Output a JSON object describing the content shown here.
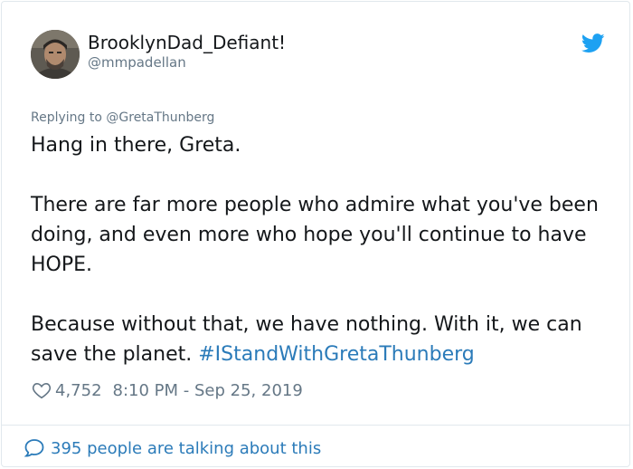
{
  "author": {
    "display_name": "BrooklynDad_Defiant!",
    "handle": "@mmpadellan",
    "avatar": "user-avatar-photo"
  },
  "reply_to": {
    "prefix": "Replying to",
    "mention": "@GretaThunberg"
  },
  "tweet": {
    "paragraphs": [
      "Hang in there, Greta.",
      "There are far more people who admire what you've been doing, and even more who hope you'll continue to have HOPE.",
      "Because without that, we have nothing. With it, we can save the planet."
    ],
    "hashtag": "#IStandWithGretaThunberg"
  },
  "meta": {
    "likes": "4,752",
    "timestamp": "8:10 PM - Sep 25, 2019"
  },
  "footer": {
    "talking_text": "395 people are talking about this"
  },
  "icons": {
    "brand": "twitter-bird-icon",
    "like": "heart-outline-icon",
    "reply": "speech-bubble-icon"
  },
  "colors": {
    "brand_blue": "#1da1f2",
    "link_blue": "#2b7bb9",
    "secondary_text": "#657786",
    "primary_text": "#14171a",
    "border": "#e1e8ed"
  }
}
